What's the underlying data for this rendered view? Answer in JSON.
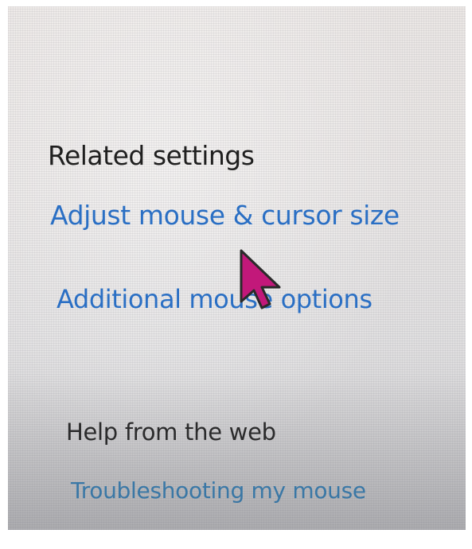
{
  "related_settings": {
    "heading": "Related settings",
    "links": [
      {
        "label": "Adjust mouse & cursor size"
      },
      {
        "label": "Additional mouse options"
      }
    ]
  },
  "help": {
    "heading": "Help from the web",
    "links": [
      {
        "label": "Troubleshooting my mouse"
      }
    ]
  },
  "cursor": {
    "icon": "arrow-pointer-icon",
    "fill_color": "#c2187a",
    "outline_color": "#2a2a2a"
  },
  "colors": {
    "link": "#2a6fc4",
    "heading": "#1f1f1f"
  }
}
